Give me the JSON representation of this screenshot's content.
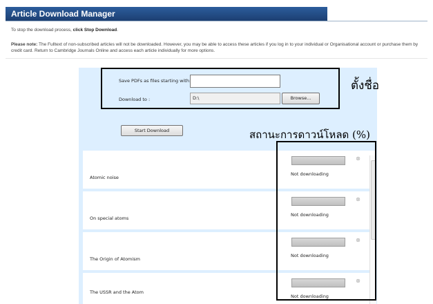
{
  "header": {
    "title": "Article Download Manager"
  },
  "intro": {
    "prefix": "To stop the download process, ",
    "bold": "click Stop Download",
    "suffix": "."
  },
  "note": {
    "label": "Please note:",
    "text": " The Fulltext of non-subscribed articles will not be downloaded. However, you may be able to access these articles if you log in to your individual or Organisational account or purchase them by credit card. Return to Cambridge Journals Online and access each article individually for more options."
  },
  "form": {
    "prefix_label": "Save PDFs as files starting with:",
    "prefix_value": "",
    "download_to_label": "Download to :",
    "download_to_value": "D:\\",
    "browse_label": "Browse...",
    "start_label": "Start Download"
  },
  "annotations": {
    "name_label": "ตั้งชื่อ",
    "status_label": "สถานะการดาวน์โหลด (%)"
  },
  "articles": [
    {
      "title": "Atomic noise",
      "status": "Not downloading",
      "progress": 0
    },
    {
      "title": "On special atoms",
      "status": "Not downloading",
      "progress": 0
    },
    {
      "title": "The Origin of Atomism",
      "status": "Not downloading",
      "progress": 0
    },
    {
      "title": "The USSR and the Atom",
      "status": "Not downloading",
      "progress": 0
    }
  ],
  "icons": {
    "cancel": "cancel-circle-icon"
  }
}
